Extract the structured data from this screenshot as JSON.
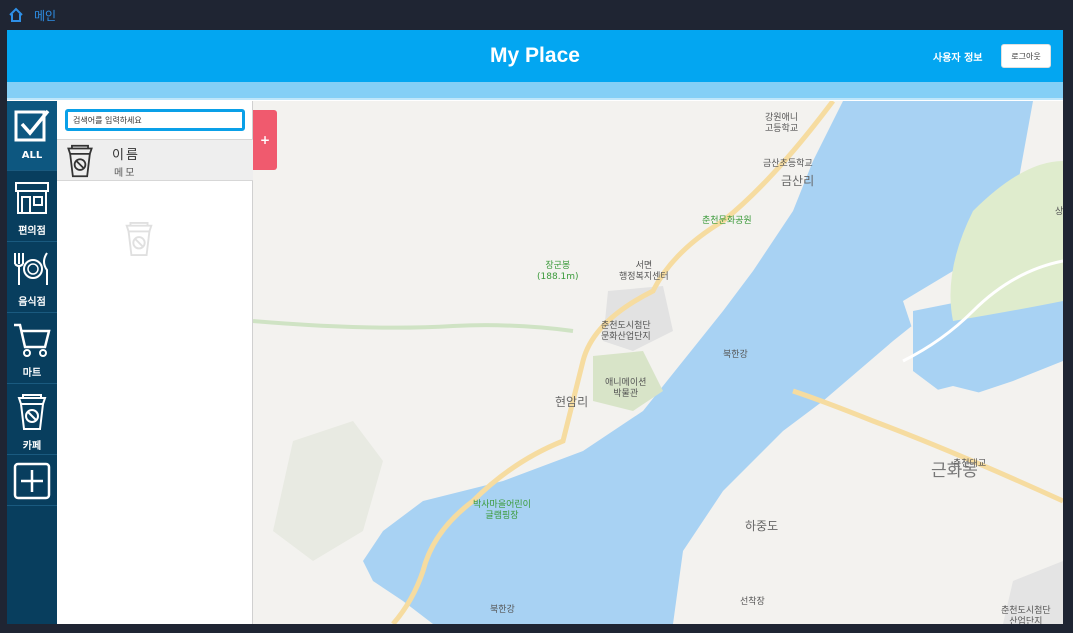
{
  "topnav": {
    "home_label": "메인"
  },
  "header": {
    "title": "My Place",
    "user_info": "사용자 정보",
    "logout": "로그아웃"
  },
  "sidebar": {
    "categories": [
      {
        "label": "ALL",
        "icon": "checkbox-icon",
        "active": true
      },
      {
        "label": "편의점",
        "icon": "store-icon"
      },
      {
        "label": "음식점",
        "icon": "utensils-icon"
      },
      {
        "label": "마트",
        "icon": "cart-icon"
      },
      {
        "label": "카페",
        "icon": "cafe-cup-icon"
      },
      {
        "label": "",
        "icon": "add-category-icon"
      }
    ]
  },
  "panel": {
    "search_placeholder": "검색어를 입력하세요",
    "items": [
      {
        "name": "이름",
        "memo": "메모",
        "icon": "cafe-cup-icon"
      }
    ],
    "empty_icon": "cafe-cup-icon"
  },
  "add_button": "+",
  "map": {
    "labels": {
      "school1": "강원애니\n고등학교",
      "school2": "금산초등학교",
      "geumsan": "금산리",
      "park": "춘천문화공원",
      "mountain": "장군봉\n(188.1m)",
      "office": "서면\n행정복지센터",
      "complex": "춘천도시첨단\n문화산업단지",
      "river": "북한강",
      "museum": "애니메이션\n박물관",
      "hyeonam": "현암리",
      "bridge": "춘천대교",
      "geunhwa": "근화동",
      "playground": "박사마을어린이\n글램핑장",
      "hajungdo": "하중도",
      "seonjak": "선착장",
      "river2": "북한강",
      "complex2": "춘천도시첨단\n산업단지",
      "edge": "상"
    }
  },
  "colors": {
    "header": "#03a6f1",
    "sidebar": "#083e5e",
    "water": "#a8d2f3",
    "add": "#f05a6e"
  }
}
